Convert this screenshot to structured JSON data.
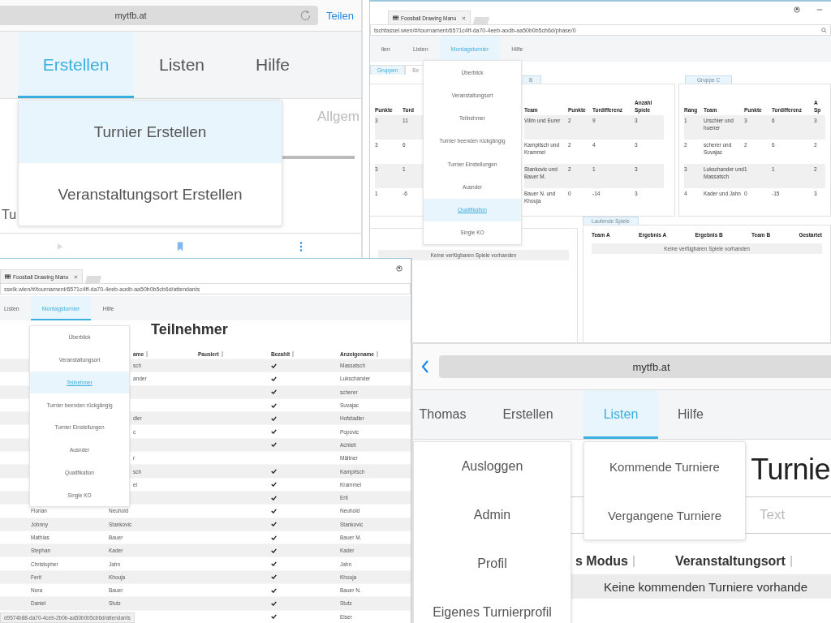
{
  "top_left": {
    "address": "mytfb.at",
    "share": "Teilen",
    "tabs": [
      {
        "label": "Erstellen",
        "selected": true
      },
      {
        "label": "Listen",
        "selected": false
      },
      {
        "label": "Hilfe",
        "selected": false
      }
    ],
    "menu": [
      {
        "label": "Turnier Erstellen",
        "selected": true
      },
      {
        "label": "Veranstaltungsort Erstellen",
        "selected": false
      }
    ],
    "heading_cut": "Allgem",
    "label_cut": "Tu"
  },
  "top_right": {
    "browser_tab": "Foosball Drawing Manu",
    "url": "tschfassel.wien/#/tournament/6571c4ff-da70-4eeb-aodb-aa50b0b5cb6d/phase/0",
    "nav": [
      {
        "label": "llen",
        "selected": false
      },
      {
        "label": "Listen",
        "selected": false
      },
      {
        "label": "Montagsturnier",
        "selected": true
      },
      {
        "label": "Hilfe",
        "selected": false
      }
    ],
    "menu": [
      {
        "label": "Überblick",
        "selected": false
      },
      {
        "label": "Veranstaltungsort",
        "selected": false
      },
      {
        "label": "Teilnehmer",
        "selected": false
      },
      {
        "label": "Turnier beenden rückgängig",
        "selected": false
      },
      {
        "label": "Turnier Einstellungen",
        "selected": false
      },
      {
        "label": "Ausnder",
        "selected": false
      },
      {
        "label": "Qualifikation",
        "selected": true
      },
      {
        "label": "Single KO",
        "selected": false
      }
    ],
    "subtabs": [
      {
        "label": "Gruppen",
        "selected": true
      },
      {
        "label": "Be",
        "selected": false
      }
    ],
    "groups": [
      {
        "columns": [
          "Punkte",
          "Tord"
        ],
        "rows": [
          [
            "3",
            "11"
          ],
          [
            "3",
            "6"
          ],
          [
            "3",
            "1"
          ],
          [
            "1",
            "-6"
          ]
        ]
      },
      {
        "tab": "B",
        "columns": [
          "Team",
          "Punkte",
          "Tordifferenz",
          "Anzahl Spiele"
        ],
        "rows": [
          [
            "Vilim und Eurer",
            "2",
            "9",
            "3"
          ],
          [
            "Kampitsch und Krammel",
            "2",
            "4",
            "3"
          ],
          [
            "Stankovic und Bauer M.",
            "2",
            "1",
            "3"
          ],
          [
            "Bauer N. und Khouja",
            "0",
            "-14",
            "3"
          ]
        ]
      },
      {
        "tab": "Gruppe C",
        "columns": [
          "Rang",
          "Team",
          "Punkte",
          "Tordifferenz",
          "A Sp"
        ],
        "rows": [
          [
            "1",
            "Urschler und huener",
            "3",
            "6",
            "3"
          ],
          [
            "2",
            "scherer und Suvajac",
            "2",
            "6",
            "2"
          ],
          [
            "3",
            "Lukschander und Massatsch",
            "1",
            "1",
            "2"
          ],
          [
            "4",
            "Kader und Jahn",
            "0",
            "-15",
            "3"
          ]
        ]
      }
    ],
    "open_games": {
      "empty": "Keine verfügbaren Spiele vorhanden"
    },
    "running_games": {
      "tab": "Laufende Spiele",
      "columns": [
        "Team A",
        "Ergebnis A",
        "Ergebnis B",
        "Team B",
        "Gestartet"
      ],
      "empty": "Keine verfügbaren Spiele vorhanden"
    }
  },
  "bottom_left": {
    "browser_tab": "Foosball Drawing Manu",
    "url": "sselk.wien/#/tournament/6571c4ff-da70-4eeb-aodb-aa50b0b5cb6d/attendants",
    "nav": [
      {
        "label": "Listen",
        "selected": false
      },
      {
        "label": "Montagsturnier",
        "selected": true
      },
      {
        "label": "Hilfe",
        "selected": false
      }
    ],
    "menu": [
      {
        "label": "Überblick",
        "selected": false
      },
      {
        "label": "Veranstaltungsort",
        "selected": false
      },
      {
        "label": "Teilnehmer",
        "selected": true
      },
      {
        "label": "Turnier beenden rückgängig",
        "selected": false
      },
      {
        "label": "Turnier Einstellungen",
        "selected": false
      },
      {
        "label": "Ausnder",
        "selected": false
      },
      {
        "label": "Qualifikation",
        "selected": false
      },
      {
        "label": "Single KO",
        "selected": false
      }
    ],
    "title": "Teilnehmer",
    "columns": [
      "ame",
      "Pausiert",
      "Bezahlt",
      "Anzeigename"
    ],
    "rows": [
      {
        "last": "sch",
        "paid": true,
        "display": "Massatsch"
      },
      {
        "last": "ander",
        "paid": true,
        "display": "Lukschander"
      },
      {
        "paid": true,
        "display": "scherer"
      },
      {
        "paid": true,
        "display": "Suvajac"
      },
      {
        "last": "dler",
        "paid": true,
        "display": "Hofstadler"
      },
      {
        "last": "c",
        "paid": true,
        "display": "Popovic"
      },
      {
        "paid": true,
        "display": "Achleit"
      },
      {
        "last": "r",
        "paid": false,
        "display": "Mältner"
      },
      {
        "last": "sch",
        "paid": true,
        "display": "Kampitsch"
      },
      {
        "last": "el",
        "paid": true,
        "display": "Krammel"
      },
      {
        "paid": true,
        "display": "Ertl"
      },
      {
        "first": "Florian",
        "last": "Neuhold",
        "paid": true,
        "display": "Neuhold"
      },
      {
        "first": "Johnny",
        "last": "Stankovic",
        "paid": true,
        "display": "Stankovic"
      },
      {
        "first": "Mathias",
        "last": "Bauer",
        "paid": true,
        "display": "Bauer M."
      },
      {
        "first": "Stephan",
        "last": "Kader",
        "paid": true,
        "display": "Kader"
      },
      {
        "first": "Christopher",
        "last": "Jahn",
        "paid": true,
        "display": "Jahn"
      },
      {
        "first": "Ferit",
        "last": "Khouja",
        "paid": true,
        "display": "Khouja"
      },
      {
        "first": "Nora",
        "last": "Bauer",
        "paid": true,
        "display": "Bauer N."
      },
      {
        "first": "Daniel",
        "last": "Stutz",
        "paid": true,
        "display": "Stutz"
      },
      {
        "paid": true,
        "display": "Elser"
      }
    ],
    "status_url": "d9574b88-da70-4ceb-2b0b-aa50b0b5cb6d/attendants"
  },
  "bottom_right": {
    "address": "mytfb.at",
    "nav": [
      {
        "label": "Thomas",
        "selected": false
      },
      {
        "label": "Erstellen",
        "selected": false
      },
      {
        "label": "Listen",
        "selected": true
      },
      {
        "label": "Hilfe",
        "selected": false
      }
    ],
    "user_menu": [
      "Ausloggen",
      "Admin",
      "Profil",
      "Eigenes Turnierprofil"
    ],
    "lists_menu": [
      "Kommende Turniere",
      "Vergangene Turniere"
    ],
    "heading": "Turnie",
    "search_placeholder": "Text",
    "columns": [
      "s Modus",
      "Veranstaltungsort"
    ],
    "empty": "Keine kommenden Turniere vorhande"
  }
}
